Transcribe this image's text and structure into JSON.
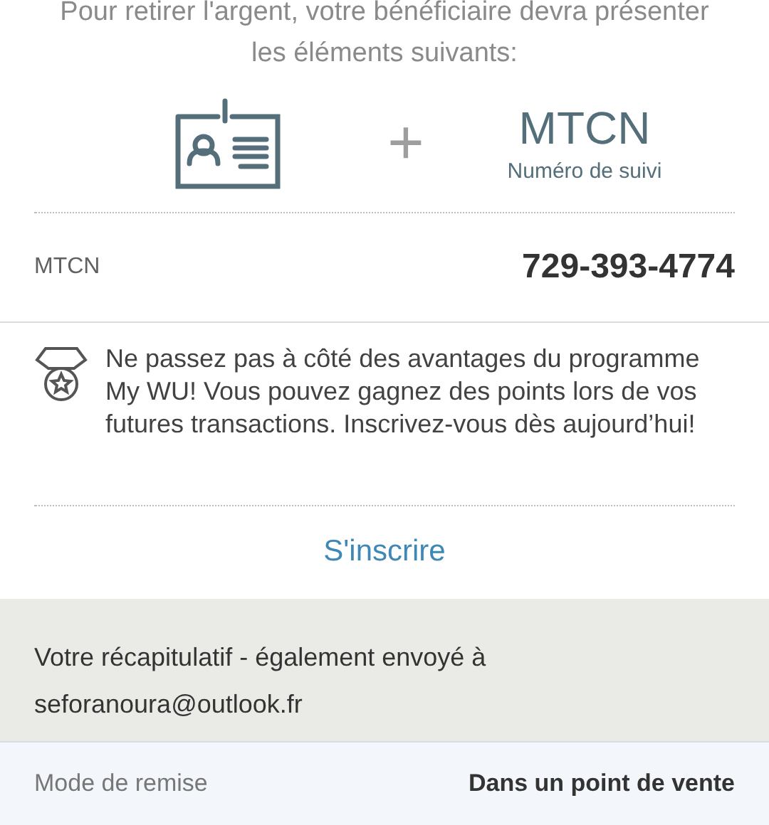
{
  "intro": "Pour retirer l'argent, votre bénéficiaire devra présenter les éléments suivants:",
  "requirements": {
    "plus": "+",
    "code_title": "MTCN",
    "code_caption": "Numéro de suivi"
  },
  "mtcn_row": {
    "label": "MTCN",
    "value": "729-393-4774"
  },
  "rewards": {
    "message": "Ne passez pas à côté des avantages du programme My WU! Vous pouvez gagnez des points lors de vos futures transactions. Inscrivez-vous dès aujourd’hui!",
    "action": "S'inscrire"
  },
  "summary": {
    "heading": "Votre récapitulatif - également envoyé à",
    "email": "seforanoura@outlook.fr"
  },
  "details": [
    {
      "label": "Mode de remise",
      "value": "Dans un point de vente"
    }
  ]
}
